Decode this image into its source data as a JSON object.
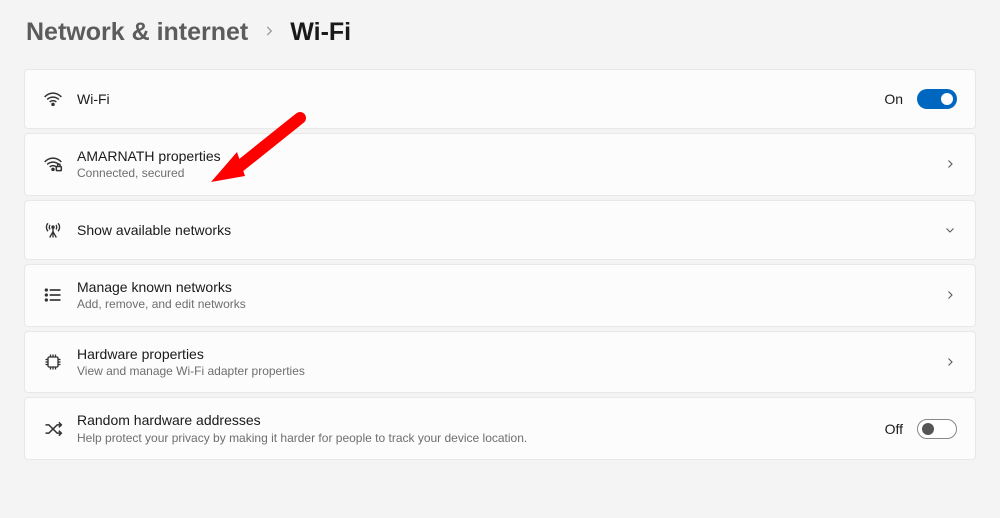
{
  "breadcrumb": {
    "parent": "Network & internet",
    "current": "Wi-Fi"
  },
  "rows": {
    "wifi": {
      "title": "Wi-Fi",
      "state_label": "On"
    },
    "network": {
      "title": "AMARNATH properties",
      "sub": "Connected, secured"
    },
    "available": {
      "title": "Show available networks"
    },
    "known": {
      "title": "Manage known networks",
      "sub": "Add, remove, and edit networks"
    },
    "hardware": {
      "title": "Hardware properties",
      "sub": "View and manage Wi-Fi adapter properties"
    },
    "random": {
      "title": "Random hardware addresses",
      "sub": "Help protect your privacy by making it harder for people to track your device location.",
      "state_label": "Off"
    }
  }
}
